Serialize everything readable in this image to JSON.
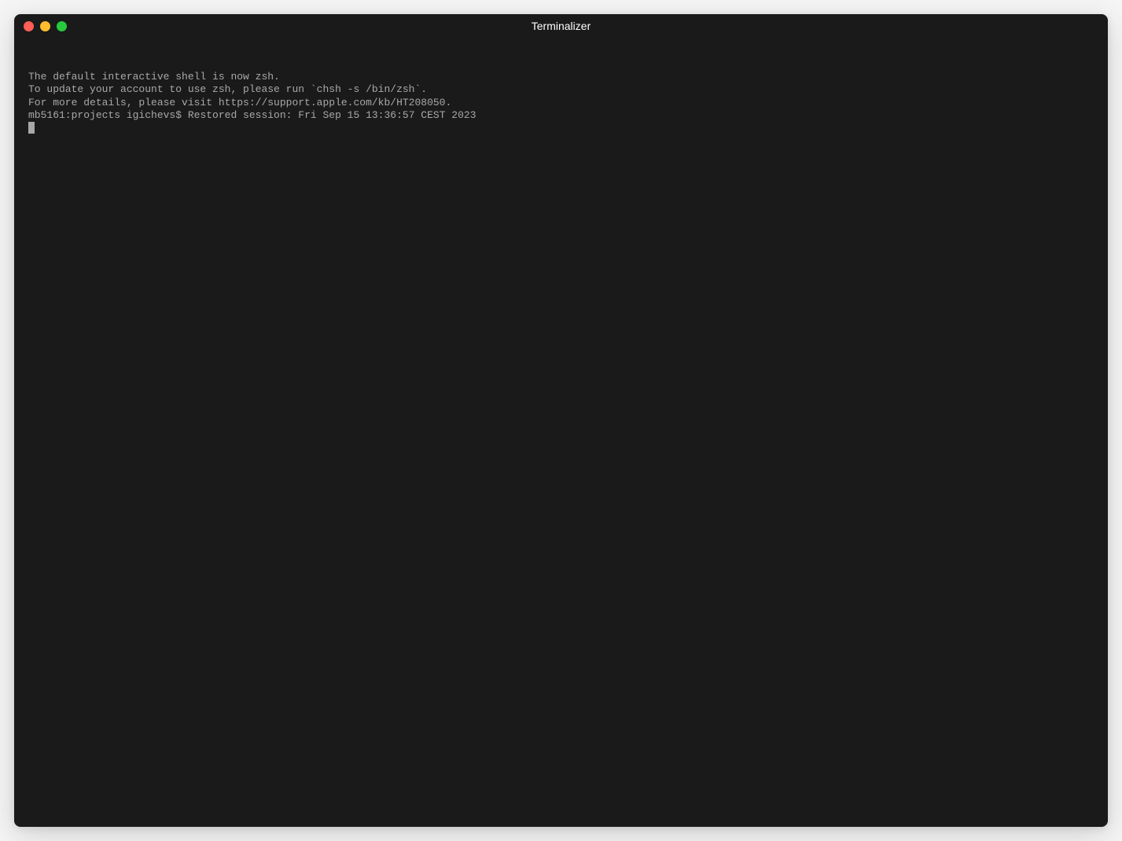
{
  "window": {
    "title": "Terminalizer",
    "colors": {
      "background": "#1a1a1a",
      "text": "#a8a8a8",
      "traffic_red": "#ff5f56",
      "traffic_yellow": "#ffbd2e",
      "traffic_green": "#27c93f"
    }
  },
  "terminal": {
    "lines": [
      "The default interactive shell is now zsh.",
      "To update your account to use zsh, please run `chsh -s /bin/zsh`.",
      "For more details, please visit https://support.apple.com/kb/HT208050."
    ],
    "prompt": "mb5161:projects igichevs$ ",
    "prompt_output": "Restored session: Fri Sep 15 13:36:57 CEST 2023"
  }
}
